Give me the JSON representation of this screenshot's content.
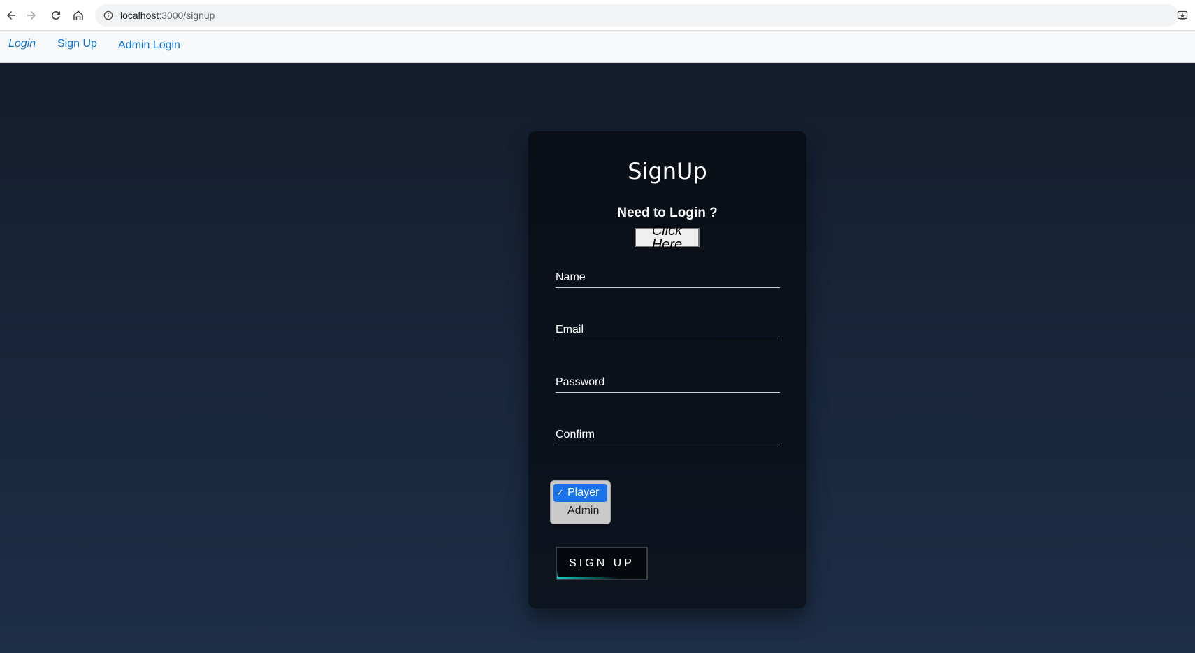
{
  "browser": {
    "url_host": "localhost",
    "url_path": ":3000/signup"
  },
  "nav": {
    "items": [
      {
        "label": "Login",
        "active": true
      },
      {
        "label": "Sign Up",
        "active": false
      },
      {
        "label": "Admin Login",
        "active": false
      }
    ]
  },
  "card": {
    "title": "SignUp",
    "need_login": "Need to Login ?",
    "click_here": "Click Here",
    "fields": {
      "name_placeholder": "Name",
      "email_placeholder": "Email",
      "password_placeholder": "Password",
      "confirm_placeholder": "Confirm"
    },
    "role_select": {
      "options": [
        "Player",
        "Admin"
      ],
      "selected": "Player"
    },
    "submit_label": "SIGN UP"
  },
  "colors": {
    "link": "#0b72d9",
    "selected_option": "#1a73e8",
    "button_glow": "#13d1c9"
  }
}
